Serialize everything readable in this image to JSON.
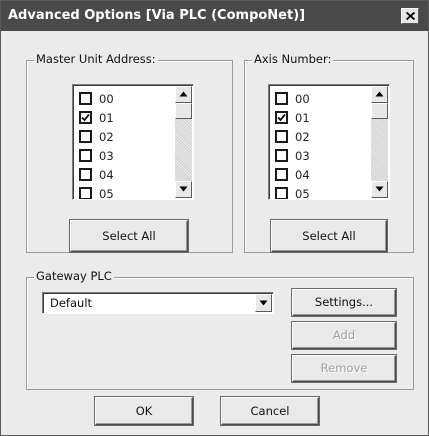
{
  "window": {
    "title": "Advanced Options [Via PLC (CompoNet)]",
    "close_icon": "close-icon"
  },
  "master_unit": {
    "label": "Master Unit Address:",
    "items": [
      {
        "label": "00",
        "checked": false
      },
      {
        "label": "01",
        "checked": true
      },
      {
        "label": "02",
        "checked": false
      },
      {
        "label": "03",
        "checked": false
      },
      {
        "label": "04",
        "checked": false
      },
      {
        "label": "05",
        "checked": false
      }
    ],
    "select_all_label": "Select All"
  },
  "axis_number": {
    "label": "Axis Number:",
    "items": [
      {
        "label": "00",
        "checked": false
      },
      {
        "label": "01",
        "checked": true
      },
      {
        "label": "02",
        "checked": false
      },
      {
        "label": "03",
        "checked": false
      },
      {
        "label": "04",
        "checked": false
      },
      {
        "label": "05",
        "checked": false
      }
    ],
    "select_all_label": "Select All"
  },
  "gateway": {
    "label": "Gateway PLC",
    "selected_value": "Default",
    "settings_label": "Settings...",
    "add_label": "Add",
    "remove_label": "Remove"
  },
  "footer": {
    "ok_label": "OK",
    "cancel_label": "Cancel"
  },
  "colors": {
    "titlebar": "#4a4a4a",
    "dialog_bg": "#ebebeb",
    "disabled_text": "#a0a0a0"
  }
}
